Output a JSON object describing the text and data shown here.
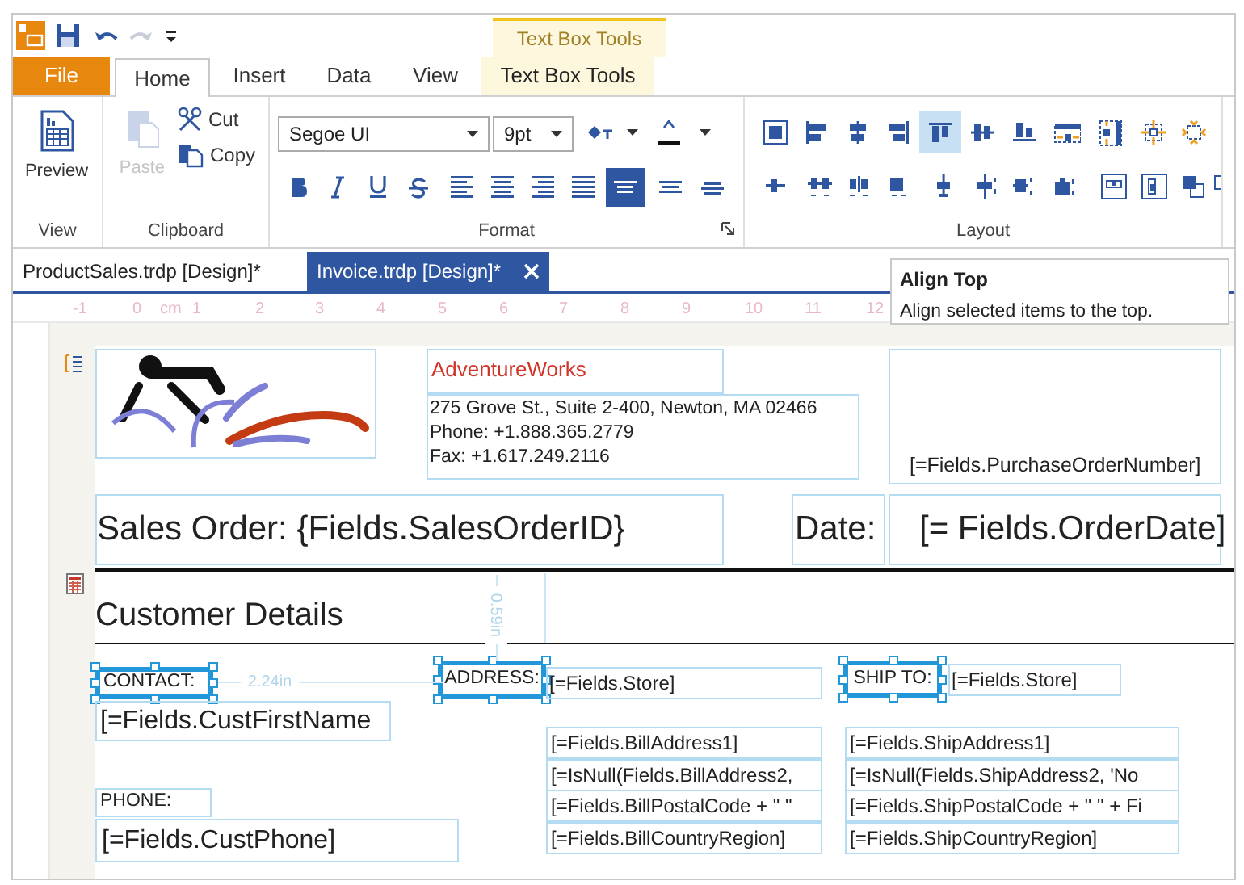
{
  "contextual_group": {
    "label": "Text Box Tools"
  },
  "tabs": [
    {
      "label": "File",
      "kind": "file",
      "selected": false
    },
    {
      "label": "Home",
      "kind": "normal",
      "selected": true
    },
    {
      "label": "Insert",
      "kind": "normal",
      "selected": false
    },
    {
      "label": "Data",
      "kind": "normal",
      "selected": false
    },
    {
      "label": "View",
      "kind": "normal",
      "selected": false
    },
    {
      "label": "Text Box Tools",
      "kind": "contextual",
      "selected": false
    }
  ],
  "ribbon": {
    "view_group": {
      "label": "View",
      "preview": "Preview"
    },
    "clipboard_group": {
      "label": "Clipboard",
      "paste": {
        "label": "Paste",
        "disabled": true
      },
      "cut": "Cut",
      "copy": "Copy"
    },
    "format_group": {
      "label": "Format",
      "font": "Segoe UI",
      "size": "9pt",
      "style_buttons": [
        {
          "selected": false
        },
        {
          "selected": false
        },
        {
          "selected": false
        },
        {
          "selected": false
        },
        {
          "selected": false
        },
        {
          "selected": false
        },
        {
          "selected": false
        },
        {
          "selected": false
        },
        {
          "selected": true
        },
        {
          "selected": false
        },
        {
          "selected": false
        }
      ]
    },
    "layout_group": {
      "label": "Layout",
      "buttons": [
        {
          "selected": false
        },
        {
          "selected": false
        },
        {
          "selected": false
        },
        {
          "selected": false
        },
        {
          "selected": true
        },
        {
          "selected": false
        },
        {
          "selected": false
        },
        {
          "selected": false
        },
        {
          "selected": false
        },
        {
          "selected": false
        },
        {
          "selected": false
        },
        {
          "selected": false
        },
        {
          "selected": false
        },
        {
          "selected": false
        },
        {
          "selected": false
        },
        {
          "selected": false
        },
        {
          "selected": false
        },
        {
          "selected": false
        },
        {
          "selected": false
        },
        {
          "selected": false
        },
        {
          "selected": false
        },
        {
          "selected": false
        },
        {
          "selected": false
        }
      ]
    }
  },
  "document_tabs": [
    {
      "label": "ProductSales.trdp [Design]*",
      "selected": false
    },
    {
      "label": "Invoice.trdp [Design]*",
      "selected": true
    }
  ],
  "tooltip": {
    "title": "Align Top",
    "text": "Align selected items to the top."
  },
  "ruler": {
    "labels": [
      "-1",
      "0",
      "cm",
      "1",
      "2",
      "3",
      "4",
      "5",
      "6",
      "7",
      "8",
      "9",
      "10",
      "11",
      "12"
    ]
  },
  "report": {
    "header": {
      "company_name": "AdventureWorks",
      "address_lines": [
        "275 Grove St., Suite 2-400, Newton, MA 02466",
        "Phone: +1.888.365.2779",
        "Fax: +1.617.249.2116"
      ],
      "purchase_order": "[=Fields.PurchaseOrderNumber]"
    },
    "title_row": {
      "sales_order": "Sales Order: {Fields.SalesOrderID}",
      "date_label": "Date:",
      "order_date": "[= Fields.OrderDate]"
    },
    "customer_section": {
      "title": "Customer Details",
      "contact_label": {
        "text": "CONTACT:",
        "selected": true
      },
      "contact_value": "[=Fields.CustFirstName",
      "phone_label": "PHONE:",
      "phone_value": "[=Fields.CustPhone]",
      "address_label": {
        "text": "ADDRESS:",
        "selected": true
      },
      "bill_store": "[=Fields.Store]",
      "bill_lines": [
        "[=Fields.BillAddress1]",
        "[=IsNull(Fields.BillAddress2,",
        "[=Fields.BillPostalCode + \" \"",
        "[=Fields.BillCountryRegion]"
      ],
      "ship_label": {
        "text": "SHIP TO:",
        "selected": true
      },
      "ship_store": "[=Fields.Store]",
      "ship_lines": [
        "[=Fields.ShipAddress1]",
        "[=IsNull(Fields.ShipAddress2, 'No",
        "[=Fields.ShipPostalCode + \" \" + Fi",
        "[=Fields.ShipCountryRegion]"
      ]
    },
    "measures": {
      "horizontal": "2.24in",
      "vertical": "0.59in"
    }
  }
}
